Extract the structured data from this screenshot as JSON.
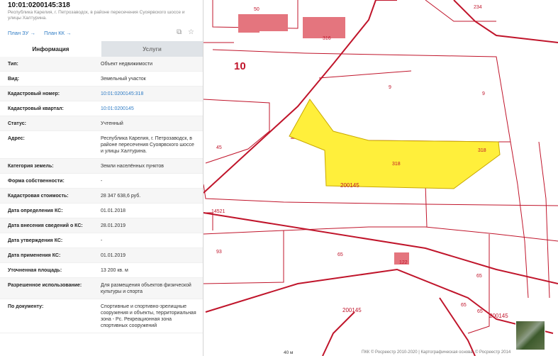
{
  "header": {
    "title": "10:01:0200145:318",
    "subtitle": "Республика Карелия, г. Петрозаводск, в районе пересечения Суоярвского шоссе и улицы Халтурина."
  },
  "links": {
    "plan_zu": "План ЗУ →",
    "plan_kk": "План КК →"
  },
  "tabs": [
    {
      "label": "Информация"
    },
    {
      "label": "Услуги"
    }
  ],
  "rows": [
    {
      "key": "Тип:",
      "value": "Объект недвижимости"
    },
    {
      "key": "Вид:",
      "value": "Земельный участок"
    },
    {
      "key": "Кадастровый номер:",
      "value": "10:01:0200145:318"
    },
    {
      "key": "Кадастровый квартал:",
      "value": "10:01:0200145"
    },
    {
      "key": "Статус:",
      "value": "Учтенный"
    },
    {
      "key": "Адрес:",
      "value": "Республика Карелия, г. Петрозаводск, в районе пересечения Суоярвского шоссе и улицы Халтурина."
    },
    {
      "key": "Категория земель:",
      "value": "Земли населённых пунктов"
    },
    {
      "key": "Форма собственности:",
      "value": "-"
    },
    {
      "key": "Кадастровая стоимость:",
      "value": "28 347 638,6 руб."
    },
    {
      "key": "Дата определения КС:",
      "value": "01.01.2018"
    },
    {
      "key": "Дата внесения сведений о КС:",
      "value": "28.01.2019"
    },
    {
      "key": "Дата утверждения КС:",
      "value": "-"
    },
    {
      "key": "Дата применения КС:",
      "value": "01.01.2019"
    },
    {
      "key": "Уточненная площадь:",
      "value": "13 200 кв. м"
    },
    {
      "key": "Разрешенное использование:",
      "value": "Для размещения объектов физической культуры и спорта"
    },
    {
      "key": "По документу:",
      "value": "Спортивные и спортивно-зрелищные сооружения и объекты, территориальная зона - Рс. Рекреационная зона спортивных сооружений"
    }
  ],
  "map": {
    "labels": {
      "big10": "10",
      "n50": "50",
      "n316": "316",
      "n9a": "9",
      "n9b": "9",
      "n318a": "318",
      "n318b": "318",
      "n45": "45",
      "block200145a": "200145",
      "n14521": "14521",
      "n93": "93",
      "n65a": "65",
      "n65b": "65",
      "n65c": "65",
      "n65d": "65",
      "n122": "122",
      "block200145b": "200145",
      "block200145c": "200145",
      "n234": "234"
    },
    "scale": "40 м",
    "copyright": "ПКК © Росреестр 2010-2020 | Картографическая основа: © Росреестр 2014"
  },
  "colors": {
    "parcel_line": "#c0152b",
    "selected_fill": "#ffef3b",
    "building": "#e4757e",
    "link": "#2e7bc4"
  }
}
